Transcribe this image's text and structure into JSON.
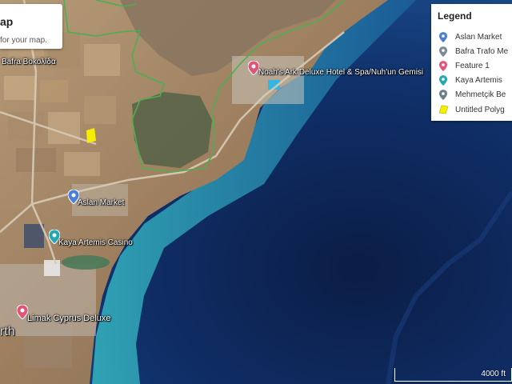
{
  "title_card": {
    "title": "ap",
    "description": "for your map."
  },
  "legend": {
    "title": "Legend",
    "items": [
      {
        "label": "Aslan Market",
        "icon": "blue-pin-icon",
        "color": "#4a7fd6"
      },
      {
        "label": "Bafra Trafo Me",
        "icon": "grey-pin-icon",
        "color": "#7a8b95"
      },
      {
        "label": "Feature 1",
        "icon": "pink-pin-icon",
        "color": "#e2557a"
      },
      {
        "label": "Kaya Artemis",
        "icon": "teal-pin-icon",
        "color": "#22a7b3"
      },
      {
        "label": "Mehmetçik Be",
        "icon": "grey-pin-icon",
        "color": "#6e7f8a"
      },
      {
        "label": "Untitled Polyg",
        "icon": "yellow-polygon-icon",
        "color": "#f5ee00"
      }
    ]
  },
  "map_labels": {
    "bafra": "Bafra Βοκολίδα",
    "noahs_ark": "Noah's Ark Deluxe Hotel & Spa/Nuh'un Gemisi",
    "aslan_market": "Aslan Market",
    "kaya_artemis": "Kaya Artemis Casino",
    "limak": "Limak Cyprus Deluxe",
    "edge": "rth"
  },
  "scale": {
    "label": "4000 ft"
  },
  "colors": {
    "boundary": "#4caf50",
    "sea_deep": "#0d2450",
    "sea_shallow": "#1a8aa6",
    "land": "#a88a6a",
    "polygon": "#f5ee00"
  }
}
